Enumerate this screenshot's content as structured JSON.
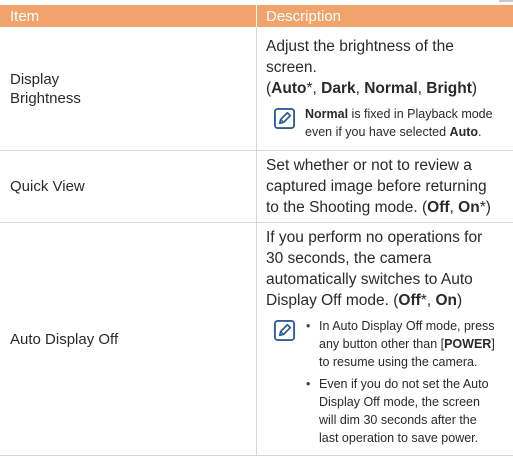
{
  "header": {
    "col_item": "Item",
    "col_description": "Description"
  },
  "rows": [
    {
      "item": [
        "Display",
        "Brightness"
      ],
      "text": "Adjust the brightness of the screen.",
      "options": {
        "open": "(",
        "o1": "Auto",
        "star": "*",
        "sep1": ", ",
        "o2": "Dark",
        "sep2": ", ",
        "o3": "Normal",
        "sep3": ", ",
        "o4": "Bright",
        "close": ")"
      },
      "note": {
        "b1": "Normal",
        "t1": " is fixed in Playback mode even if you have selected ",
        "b2": "Auto",
        "t2": "."
      }
    },
    {
      "item": "Quick View",
      "text": "Set whether or not to review a captured image before returning to the Shooting mode. ",
      "options": {
        "open": "(",
        "o1": "Off",
        "sep1": ", ",
        "o2": "On",
        "star": "*",
        "close": ")"
      }
    },
    {
      "item": "Auto Display Off",
      "text": "If you perform no operations for 30 seconds, the camera automatically switches to Auto Display Off mode. ",
      "options": {
        "open": "(",
        "o1": "Off",
        "star": "*",
        "sep1": ", ",
        "o2": "On",
        "close": ")"
      },
      "bullets": [
        {
          "t1": "In Auto Display Off mode, press any button other than [",
          "b": "POWER",
          "t2": "] to resume using the camera."
        },
        {
          "t": "Even if you do not set the Auto Display Off mode, the screen will dim 30 seconds after the last operation to save power."
        }
      ]
    }
  ],
  "colors": {
    "header_bg": "#f0a36a",
    "note_icon": "#2f5e98",
    "rule": "#d7d7d7"
  },
  "icons": {
    "note": "note-pencil-icon"
  }
}
